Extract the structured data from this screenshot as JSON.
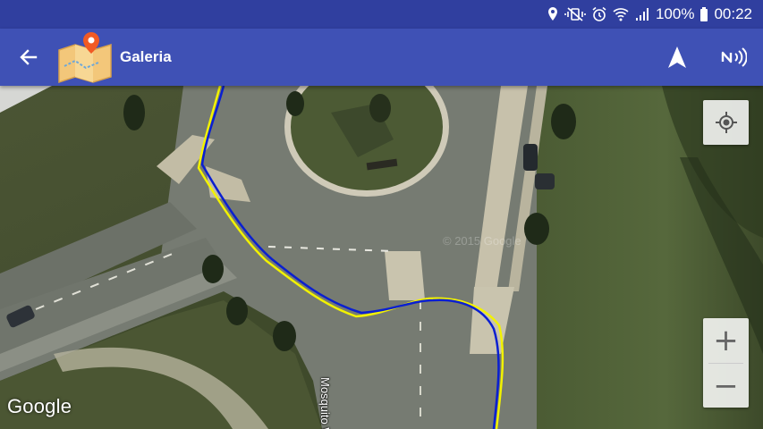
{
  "status_bar": {
    "battery_percent": "100%",
    "time": "00:22",
    "icons": [
      "location-icon",
      "vibrate-mute-icon",
      "alarm-icon",
      "wifi-icon",
      "signal-icon",
      "battery-icon"
    ]
  },
  "app_bar": {
    "title": "Galeria",
    "icons": [
      "back-arrow-icon",
      "app-map-logo",
      "navigation-arrow-icon",
      "nfc-icon"
    ],
    "background": "#3f51b5",
    "status_background": "#303f9f"
  },
  "map": {
    "type": "satellite",
    "street_label": "Mosquito Way",
    "attribution": "Google",
    "track_colors": {
      "primary": "#0a1fd1",
      "secondary": "#f2f200"
    },
    "controls": {
      "locate": "my-location-icon",
      "zoom_in": "+",
      "zoom_out": "−"
    }
  }
}
